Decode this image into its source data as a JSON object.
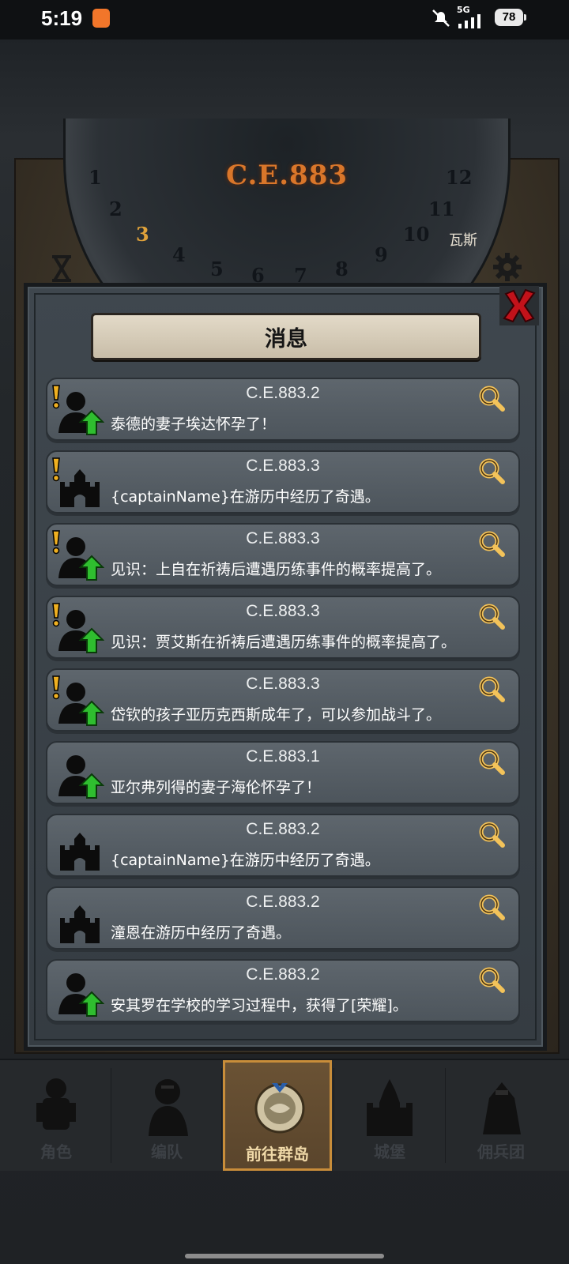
{
  "status_bar": {
    "time": "5:19",
    "network": "5G",
    "battery": "78"
  },
  "clock": {
    "year": "C.E.883",
    "digits": [
      "1",
      "2",
      "3",
      "4",
      "5",
      "6",
      "7",
      "8",
      "9",
      "10",
      "11",
      "12"
    ],
    "active_digit": "3",
    "map_label": "瓦斯"
  },
  "dialog": {
    "title": "消息",
    "messages": [
      {
        "date": "C.E.883.2",
        "text": "泰德的妻子埃达怀孕了！",
        "icon": "person-up-icon",
        "alert": true
      },
      {
        "date": "C.E.883.3",
        "text": "{captainName}在游历中经历了奇遇。",
        "icon": "castle-icon",
        "alert": true
      },
      {
        "date": "C.E.883.3",
        "text": "见识：上自在祈祷后遭遇历练事件的概率提高了。",
        "icon": "person-up-icon",
        "alert": true
      },
      {
        "date": "C.E.883.3",
        "text": "见识：贾艾斯在祈祷后遭遇历练事件的概率提高了。",
        "icon": "person-up-icon",
        "alert": true
      },
      {
        "date": "C.E.883.3",
        "text": "岱钦的孩子亚历克西斯成年了，可以参加战斗了。",
        "icon": "person-up-icon",
        "alert": true
      },
      {
        "date": "C.E.883.1",
        "text": "亚尔弗列得的妻子海伦怀孕了！",
        "icon": "person-up-icon",
        "alert": false
      },
      {
        "date": "C.E.883.2",
        "text": "{captainName}在游历中经历了奇遇。",
        "icon": "castle-icon",
        "alert": false
      },
      {
        "date": "C.E.883.2",
        "text": "潼恩在游历中经历了奇遇。",
        "icon": "castle-icon",
        "alert": false
      },
      {
        "date": "C.E.883.2",
        "text": "安其罗在学校的学习过程中，获得了[荣耀]。",
        "icon": "person-up-icon",
        "alert": false
      }
    ]
  },
  "nav": {
    "items": [
      {
        "label": "角色",
        "icon": "knight-icon"
      },
      {
        "label": "编队",
        "icon": "squad-icon"
      },
      {
        "label": "前往群岛",
        "icon": "compass-icon",
        "active": true
      },
      {
        "label": "城堡",
        "icon": "fortress-icon"
      },
      {
        "label": "佣兵团",
        "icon": "mercenary-icon"
      }
    ]
  },
  "colors": {
    "accent": "#d9762a",
    "active_border": "#c88d3a",
    "close_red": "#c2121a",
    "up_arrow": "#2fbe2f",
    "alert_yellow": "#f0b020"
  }
}
